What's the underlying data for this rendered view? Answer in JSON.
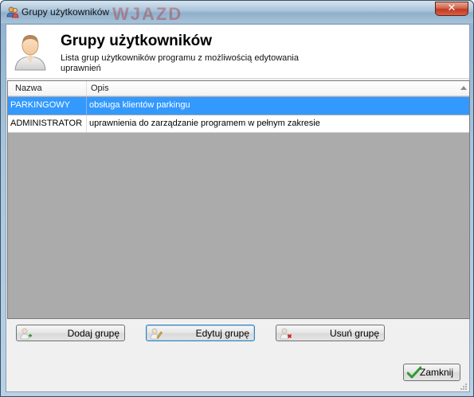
{
  "window": {
    "title": "Grupy użytkowników",
    "watermark": "WJAZD",
    "close_glyph": "✕"
  },
  "header": {
    "title": "Grupy użytkowników",
    "description": "Lista grup użytkowników programu z możliwością edytowania uprawnień",
    "icon": "user-avatar-icon"
  },
  "grid": {
    "columns": [
      "Nazwa",
      "Opis"
    ],
    "rows": [
      {
        "name": "PARKINGOWY",
        "description": "obsługa klientów parkingu",
        "selected": true
      },
      {
        "name": "ADMINISTRATOR",
        "description": "uprawnienia do zarządzanie programem w pełnym zakresie",
        "selected": false
      }
    ]
  },
  "buttons": {
    "add_label": "Dodaj grupę",
    "edit_label": "Edytuj grupę",
    "delete_label": "Usuń grupę",
    "close_label": "Zamknij"
  },
  "colors": {
    "selection": "#3399ff",
    "grid_empty": "#ababab",
    "close_button": "#c0391f"
  }
}
